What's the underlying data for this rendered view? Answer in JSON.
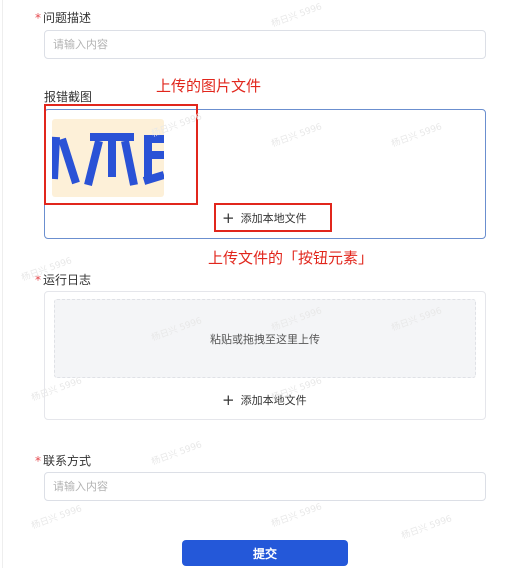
{
  "form": {
    "problem_description": {
      "required_mark": "*",
      "label": "问题描述",
      "value": "",
      "placeholder": "请输入内容"
    },
    "screenshot": {
      "label": "报错截图",
      "add_button_label": "添加本地文件",
      "thumbnail_text": "人爪钅"
    },
    "run_log": {
      "required_mark": "*",
      "label": "运行日志",
      "drop_hint": "粘贴或拖拽至这里上传",
      "add_button_label": "添加本地文件"
    },
    "contact": {
      "required_mark": "*",
      "label": "联系方式",
      "value": "",
      "placeholder": "请输入内容"
    },
    "submit_label": "提交"
  },
  "annotations": {
    "uploaded_image": "上传的图片文件",
    "upload_button": "上传文件的「按钮元素」"
  },
  "watermark": {
    "text": "杨日兴 5996"
  },
  "colors": {
    "primary": "#2458d9",
    "required": "#e5484d",
    "annotation": "#e1261c",
    "thumbnail_bg": "#fdf0d8",
    "thumbnail_glyph": "#2a52d6"
  }
}
